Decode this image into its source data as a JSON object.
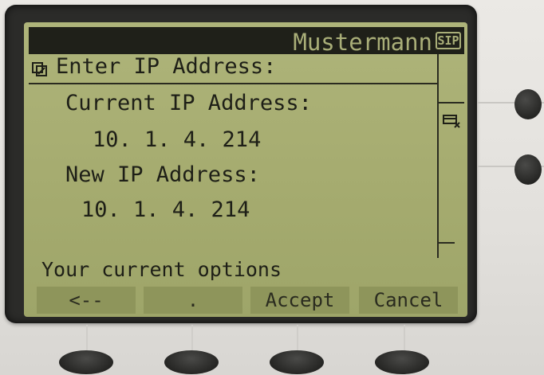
{
  "title_bar": {
    "user_name": "Mustermann",
    "badge": "SIP"
  },
  "screen": {
    "heading": "Enter IP Address:",
    "current_label": "Current IP Address:",
    "current_value": "10. 1. 4. 214",
    "new_label": "New IP Address:",
    "new_value": "10. 1. 4. 214",
    "options_label": "Your current options"
  },
  "softkeys": [
    {
      "label": "<--"
    },
    {
      "label": "."
    },
    {
      "label": "Accept"
    },
    {
      "label": "Cancel"
    }
  ],
  "icons": {
    "title_badge": "sip-icon",
    "heading_icon": "edit-icon",
    "scroll_icon": "network-icon"
  },
  "colors": {
    "lcd_background": "#a6ac70",
    "lcd_text": "#1e1f17",
    "title_bar": "#1f2019",
    "softkey": "#8e955b"
  }
}
